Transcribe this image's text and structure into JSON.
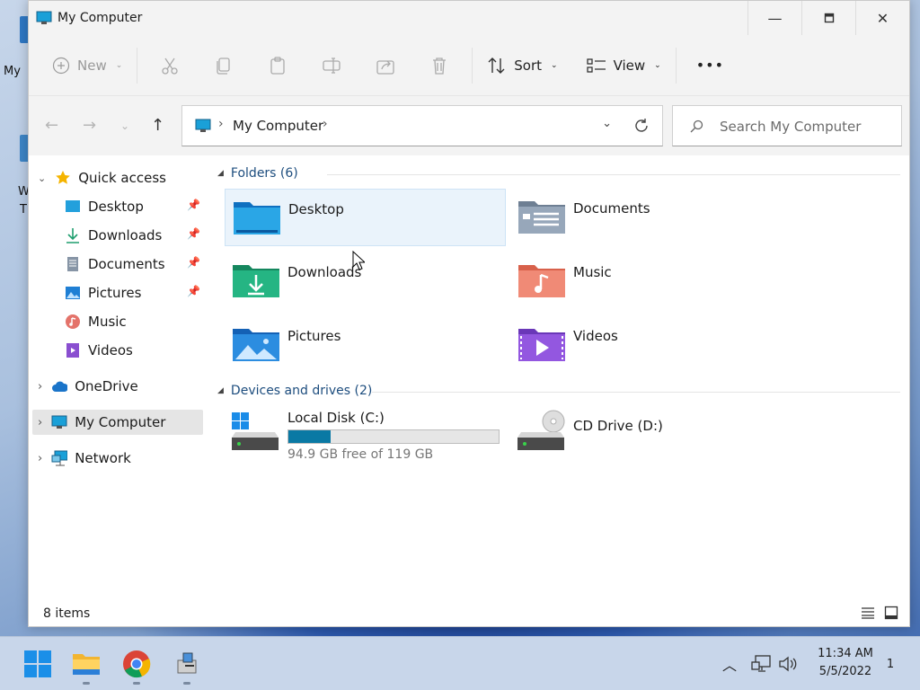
{
  "window": {
    "title": "My Computer",
    "controls": [
      "minimize",
      "maximize",
      "close"
    ]
  },
  "desktop": {
    "icon_label_1": "My",
    "icon_label_2a": "W",
    "icon_label_2b": "T"
  },
  "toolbar": {
    "new_label": "New",
    "sort_label": "Sort",
    "view_label": "View",
    "more_label": "•••"
  },
  "navigation": {
    "address_crumb": "My Computer",
    "search_placeholder": "Search My Computer"
  },
  "sidebar": {
    "quick_access": "Quick access",
    "items": [
      {
        "label": "Desktop",
        "pinned": true
      },
      {
        "label": "Downloads",
        "pinned": true
      },
      {
        "label": "Documents",
        "pinned": true
      },
      {
        "label": "Pictures",
        "pinned": true
      },
      {
        "label": "Music",
        "pinned": false
      },
      {
        "label": "Videos",
        "pinned": false
      }
    ],
    "onedrive": "OneDrive",
    "my_computer": "My Computer",
    "network": "Network"
  },
  "content": {
    "folders_header": "Folders (6)",
    "folders": [
      {
        "name": "Desktop"
      },
      {
        "name": "Documents"
      },
      {
        "name": "Downloads"
      },
      {
        "name": "Music"
      },
      {
        "name": "Pictures"
      },
      {
        "name": "Videos"
      }
    ],
    "devices_header": "Devices and drives (2)",
    "drives": [
      {
        "name": "Local Disk (C:)",
        "free_text": "94.9 GB free of 119 GB",
        "used_fraction": 0.2
      },
      {
        "name": "CD Drive (D:)"
      }
    ]
  },
  "status": {
    "item_count": "8 items"
  },
  "taskbar": {
    "time": "11:34 AM",
    "date": "5/5/2022",
    "notification_count": "1"
  },
  "colors": {
    "accent": "#0a79a4",
    "folder_blue": "#1e90d8",
    "group_header": "#1d4d7e"
  }
}
